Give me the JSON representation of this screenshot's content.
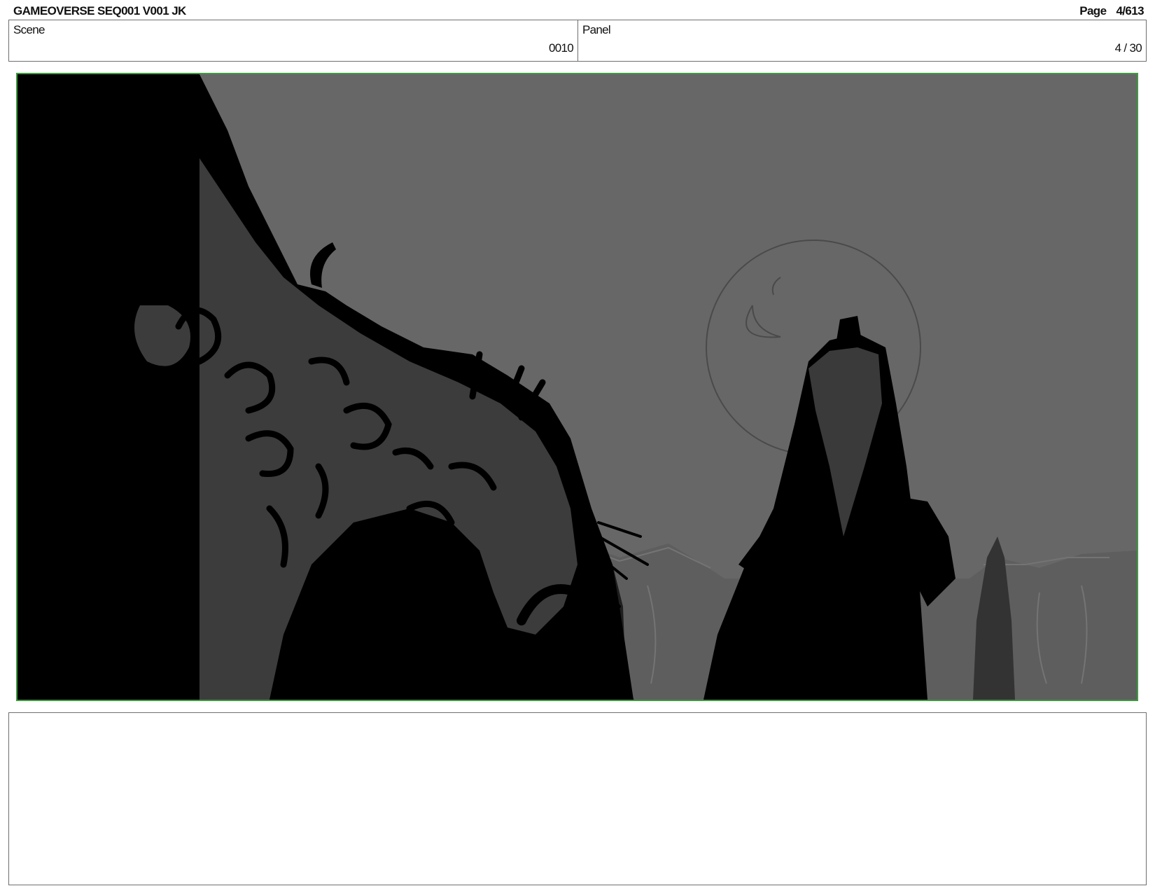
{
  "header": {
    "document_title": "GAMEOVERSE SEQ001 V001 JK",
    "page_label": "Page",
    "page_value": "4/613"
  },
  "info_bar": {
    "scene_label": "Scene",
    "scene_value": "0010",
    "panel_label": "Panel",
    "panel_value": "4 / 30"
  },
  "colors": {
    "panel_border": "#3f9b3f",
    "sky": "#676767",
    "silhouette": "#000000",
    "mid_rock": "#3c3c3c"
  },
  "artwork": {
    "subject_icons": [
      "cliff-silhouette",
      "moon-outline",
      "tower-rock",
      "distant-mountains"
    ]
  }
}
